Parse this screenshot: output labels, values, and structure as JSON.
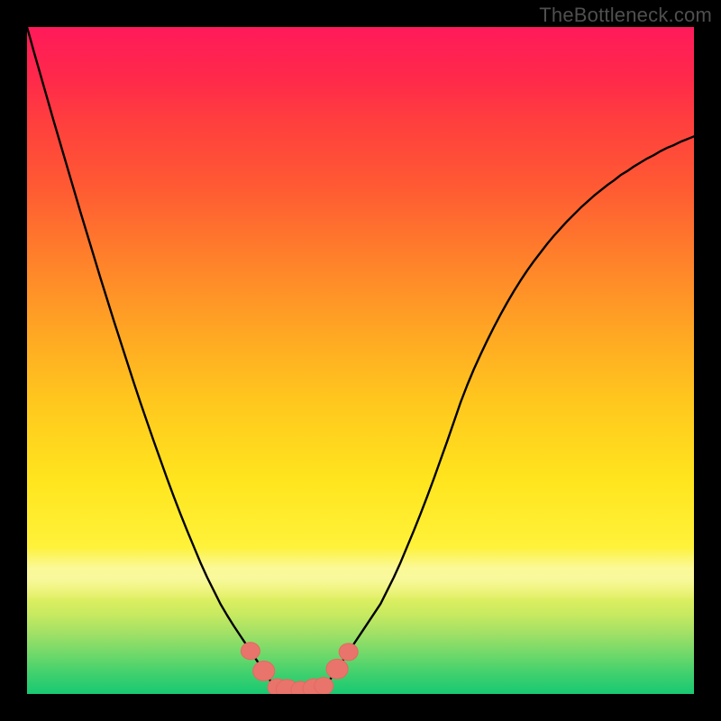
{
  "watermark": "TheBottleneck.com",
  "colors": {
    "frame": "#000000",
    "curve": "#000000",
    "blob": "#e9746b",
    "blob_stroke": "#e26a61"
  },
  "chart_data": {
    "type": "line",
    "title": "",
    "xlabel": "",
    "ylabel": "",
    "xlim": [
      0,
      100
    ],
    "ylim": [
      0,
      100
    ],
    "note": "values are the curve height (0=bottom, 100=top) sampled at integer x positions 0..100; read off from gridless gradient so approximate",
    "x": [
      0,
      1,
      2,
      3,
      4,
      5,
      6,
      7,
      8,
      9,
      10,
      11,
      12,
      13,
      14,
      15,
      16,
      17,
      18,
      19,
      20,
      21,
      22,
      23,
      24,
      25,
      26,
      27,
      28,
      29,
      30,
      31,
      32,
      33,
      34,
      35,
      36,
      37,
      38,
      39,
      40,
      41,
      42,
      43,
      44,
      45,
      46,
      47,
      48,
      49,
      50,
      51,
      52,
      53,
      54,
      55,
      56,
      57,
      58,
      59,
      60,
      61,
      62,
      63,
      64,
      65,
      66,
      67,
      68,
      69,
      70,
      71,
      72,
      73,
      74,
      75,
      76,
      77,
      78,
      79,
      80,
      81,
      82,
      83,
      84,
      85,
      86,
      87,
      88,
      89,
      90,
      91,
      92,
      93,
      94,
      95,
      96,
      97,
      98,
      99,
      100
    ],
    "values": [
      100.0,
      96.4,
      92.9,
      89.4,
      85.9,
      82.5,
      79.1,
      75.7,
      72.3,
      69.0,
      65.7,
      62.4,
      59.2,
      56.0,
      52.9,
      49.8,
      46.7,
      43.7,
      40.8,
      37.9,
      35.1,
      32.3,
      29.6,
      27.0,
      24.5,
      22.1,
      19.7,
      17.5,
      15.5,
      13.5,
      11.8,
      10.2,
      8.7,
      7.2,
      5.7,
      4.2,
      2.7,
      1.2,
      0.8,
      0.7,
      0.6,
      0.6,
      0.7,
      0.8,
      0.9,
      1.5,
      3.0,
      4.5,
      6.0,
      7.5,
      9.0,
      10.5,
      12.0,
      13.5,
      15.5,
      17.5,
      19.7,
      22.1,
      24.5,
      27.0,
      29.6,
      32.3,
      35.1,
      37.9,
      40.8,
      43.7,
      46.3,
      48.7,
      50.9,
      53.0,
      55.0,
      56.9,
      58.7,
      60.4,
      62.0,
      63.5,
      64.9,
      66.2,
      67.5,
      68.7,
      69.8,
      70.9,
      71.9,
      72.9,
      73.8,
      74.7,
      75.5,
      76.3,
      77.0,
      77.8,
      78.4,
      79.1,
      79.7,
      80.3,
      80.8,
      81.4,
      81.9,
      82.3,
      82.8,
      83.2,
      83.6
    ],
    "nadir_x_range": [
      38,
      45
    ],
    "blobs_x": [
      33.5,
      35.5,
      37.5,
      39.0,
      41.0,
      43.0,
      44.5,
      46.5,
      48.2
    ]
  }
}
